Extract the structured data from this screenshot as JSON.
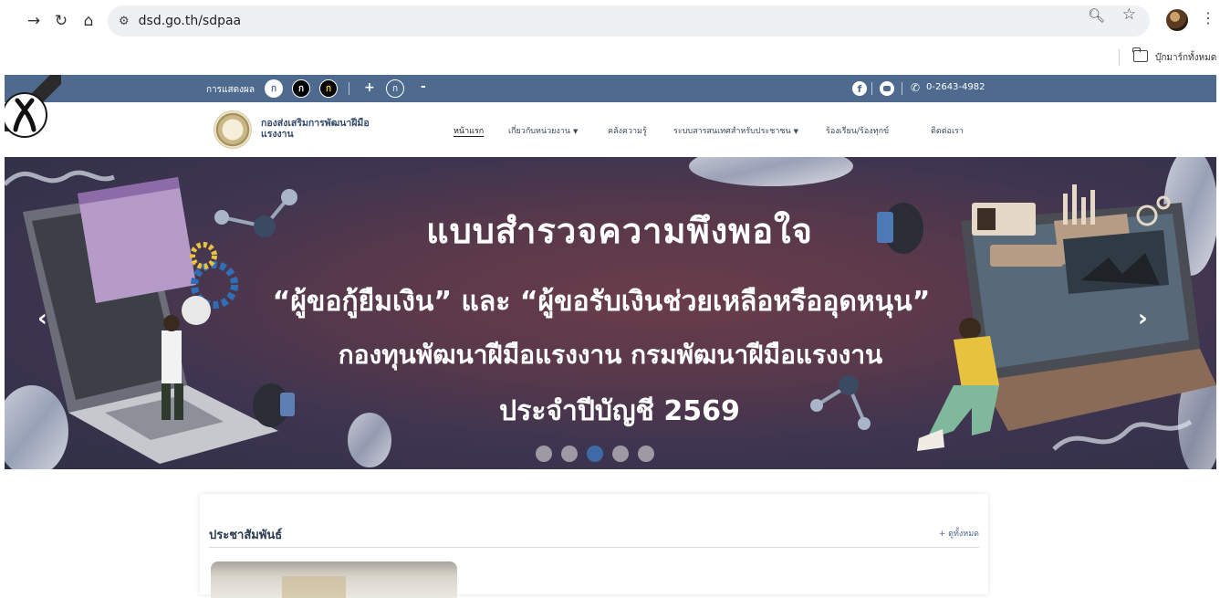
{
  "browser": {
    "url": "dsd.go.th/sdpaa",
    "bookmarks_label": "บุ๊กมาร์กทั้งหมด"
  },
  "topbar": {
    "display_label": "การแสดงผล",
    "font_buttons": [
      "ก",
      "ก",
      "ก"
    ],
    "plus": "+",
    "normal": "ก",
    "minus": "-",
    "phone": "0-2643-4982"
  },
  "header": {
    "dept_name": "กองส่งเสริมการพัฒนาฝีมือแรงงาน",
    "nav": [
      {
        "label": "หน้าแรก",
        "active": true
      },
      {
        "label": "เกี่ยวกับหน่วยงาน",
        "dropdown": true
      },
      {
        "label": "คลังความรู้"
      },
      {
        "label": "ระบบสารสนเทศสำหรับประชาชน",
        "dropdown": true
      },
      {
        "label": "ร้องเรียน/ร้องทุกข์"
      },
      {
        "label": "ติดต่อเรา"
      }
    ]
  },
  "banner": {
    "title": "แบบสำรวจความพึงพอใจ",
    "line1": "“ผู้ขอกู้ยืมเงิน” และ “ผู้ขอรับเงินช่วยเหลือหรืออุดหนุน”",
    "line2": "กองทุนพัฒนาฝีมือแรงงาน กรมพัฒนาฝีมือแรงงาน",
    "line3": "ประจำปีบัญชี 2569",
    "slide_count": 5,
    "active_slide": 3
  },
  "public_relations": {
    "title": "ประชาสัมพันธ์",
    "view_all": "+ ดูทั้งหมด"
  },
  "colors": {
    "topbar": "#4e6a8f",
    "banner": "#57384b",
    "active_dot": "#3e6aa6"
  }
}
